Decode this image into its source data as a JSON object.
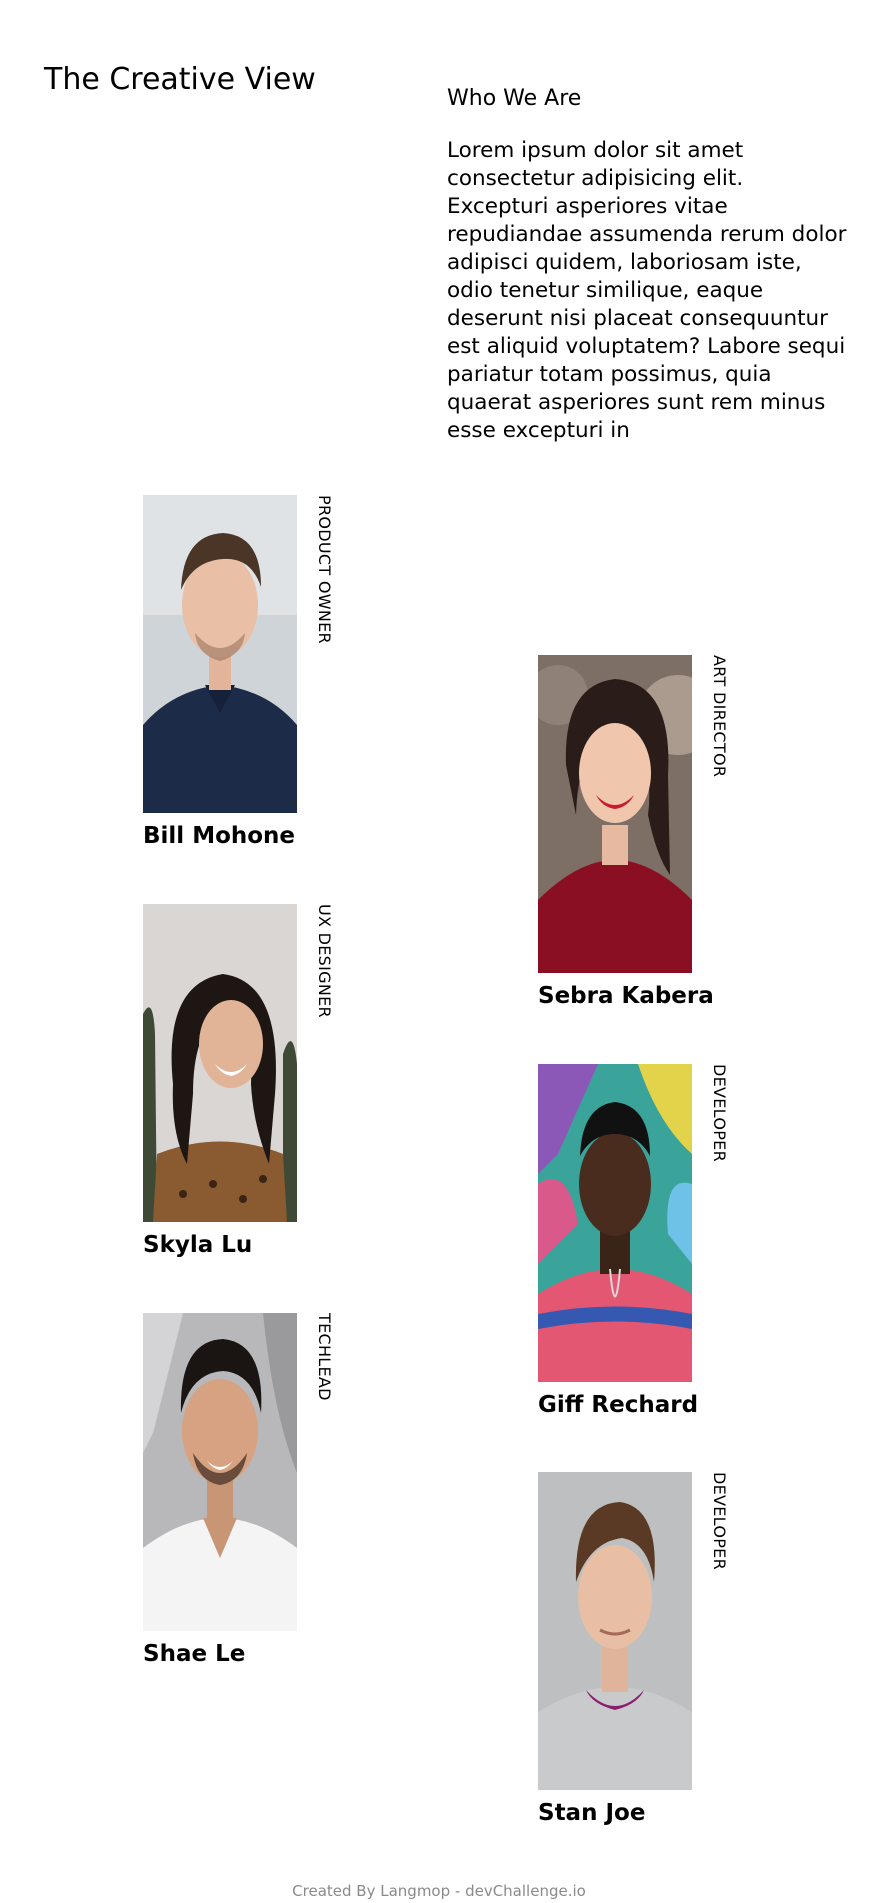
{
  "brand": {
    "title": "The Creative View"
  },
  "about": {
    "heading": "Who We Are",
    "text": "Lorem ipsum dolor sit amet consectetur adipisicing elit. Excepturi asperiores vitae repudiandae assumenda rerum dolor adipisci quidem, laboriosam iste, odio tenetur similique, eaque deserunt nisi placeat consequuntur est aliquid voluptatem? Labore sequi pariatur totam possimus, quia quaerat asperiores sunt rem minus esse excepturi in"
  },
  "team": [
    {
      "name": "Bill Mohone",
      "role": "PRODUCT OWNER",
      "photo": "portrait-photo"
    },
    {
      "name": "Sebra Kabera",
      "role": "ART DIRECTOR",
      "photo": "portrait-photo"
    },
    {
      "name": "Skyla Lu",
      "role": "UX DESIGNER",
      "photo": "portrait-photo"
    },
    {
      "name": "Giff Rechard",
      "role": "DEVELOPER",
      "photo": "portrait-photo"
    },
    {
      "name": "Shae Le",
      "role": "TECHLEAD",
      "photo": "portrait-photo"
    },
    {
      "name": "Stan Joe",
      "role": "DEVELOPER",
      "photo": "portrait-photo"
    }
  ],
  "footer": {
    "credit": "Created By Langmop - devChallenge.io"
  }
}
